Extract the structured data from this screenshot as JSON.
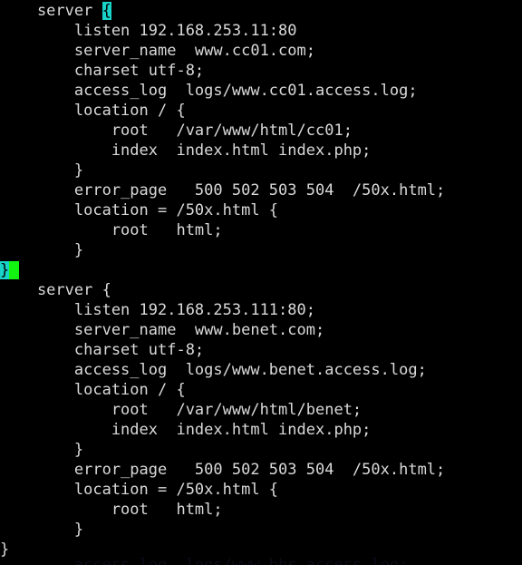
{
  "editor": {
    "kind": "terminal-text-editor",
    "file_type": "nginx-config",
    "colors": {
      "background": "#000000",
      "foreground": "#d9d9d9",
      "match_paren_background": "#19d2c8",
      "match_paren_foreground": "#000000",
      "cursor": "#12f312"
    },
    "cursor": {
      "line_index": 13,
      "column_text": "}",
      "glyph": " "
    }
  },
  "code": {
    "lines": [
      {
        "indent": 4,
        "text": "server ",
        "brace": "{",
        "highlight": true,
        "cursor": false
      },
      {
        "indent": 8,
        "text": "listen 192.168.253.11:80",
        "brace": "",
        "highlight": false,
        "cursor": false
      },
      {
        "indent": 8,
        "text": "server_name  www.cc01.com;",
        "brace": "",
        "highlight": false,
        "cursor": false
      },
      {
        "indent": 8,
        "text": "charset utf-8;",
        "brace": "",
        "highlight": false,
        "cursor": false
      },
      {
        "indent": 8,
        "text": "access_log  logs/www.cc01.access.log;",
        "brace": "",
        "highlight": false,
        "cursor": false
      },
      {
        "indent": 8,
        "text": "location / {",
        "brace": "",
        "highlight": false,
        "cursor": false
      },
      {
        "indent": 12,
        "text": "root   /var/www/html/cc01;",
        "brace": "",
        "highlight": false,
        "cursor": false
      },
      {
        "indent": 12,
        "text": "index  index.html index.php;",
        "brace": "",
        "highlight": false,
        "cursor": false
      },
      {
        "indent": 8,
        "text": "}",
        "brace": "",
        "highlight": false,
        "cursor": false
      },
      {
        "indent": 8,
        "text": "error_page   500 502 503 504  /50x.html;",
        "brace": "",
        "highlight": false,
        "cursor": false
      },
      {
        "indent": 8,
        "text": "location = /50x.html {",
        "brace": "",
        "highlight": false,
        "cursor": false
      },
      {
        "indent": 12,
        "text": "root   html;",
        "brace": "",
        "highlight": false,
        "cursor": false
      },
      {
        "indent": 8,
        "text": "}",
        "brace": "",
        "highlight": false,
        "cursor": false
      },
      {
        "indent": 0,
        "text": "",
        "brace": "}",
        "highlight": true,
        "cursor": true
      },
      {
        "indent": 4,
        "text": "server {",
        "brace": "",
        "highlight": false,
        "cursor": false
      },
      {
        "indent": 8,
        "text": "listen 192.168.253.111:80;",
        "brace": "",
        "highlight": false,
        "cursor": false
      },
      {
        "indent": 8,
        "text": "server_name  www.benet.com;",
        "brace": "",
        "highlight": false,
        "cursor": false
      },
      {
        "indent": 8,
        "text": "charset utf-8;",
        "brace": "",
        "highlight": false,
        "cursor": false
      },
      {
        "indent": 8,
        "text": "access_log  logs/www.benet.access.log;",
        "brace": "",
        "highlight": false,
        "cursor": false
      },
      {
        "indent": 8,
        "text": "location / {",
        "brace": "",
        "highlight": false,
        "cursor": false
      },
      {
        "indent": 12,
        "text": "root   /var/www/html/benet;",
        "brace": "",
        "highlight": false,
        "cursor": false
      },
      {
        "indent": 12,
        "text": "index  index.html index.php;",
        "brace": "",
        "highlight": false,
        "cursor": false
      },
      {
        "indent": 8,
        "text": "}",
        "brace": "",
        "highlight": false,
        "cursor": false
      },
      {
        "indent": 8,
        "text": "error_page   500 502 503 504  /50x.html;",
        "brace": "",
        "highlight": false,
        "cursor": false
      },
      {
        "indent": 8,
        "text": "location = /50x.html {",
        "brace": "",
        "highlight": false,
        "cursor": false
      },
      {
        "indent": 12,
        "text": "root   html;",
        "brace": "",
        "highlight": false,
        "cursor": false
      },
      {
        "indent": 8,
        "text": "}",
        "brace": "",
        "highlight": false,
        "cursor": false
      },
      {
        "indent": 0,
        "text": "}",
        "brace": "",
        "highlight": false,
        "cursor": false
      }
    ],
    "clipped_bottom_line": "        access_log  logs/www.bbs.access.log;"
  }
}
